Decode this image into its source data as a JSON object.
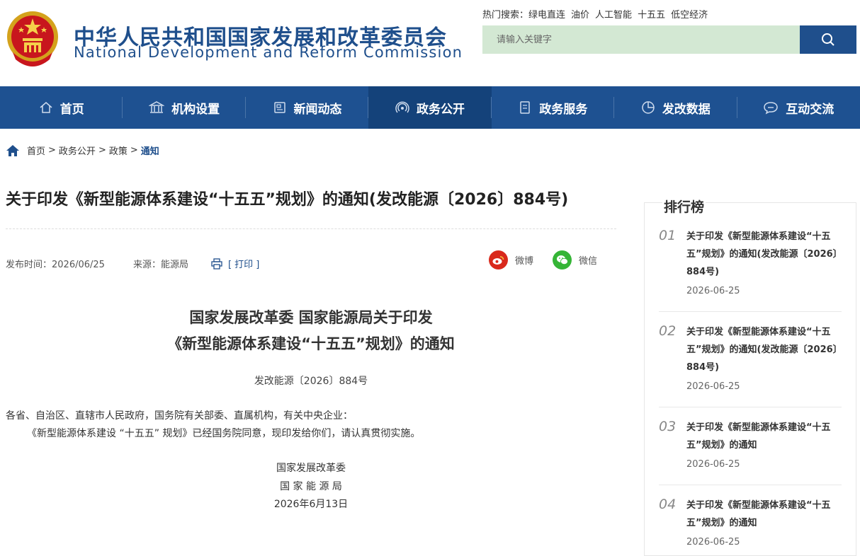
{
  "header": {
    "title": "中华人民共和国国家发展和改革委员会",
    "subtitle": "National Development and Reform Commission",
    "hot_label": "热门搜索：",
    "hot_terms": [
      "绿电直连",
      "油价",
      "人工智能",
      "十五五",
      "低空经济"
    ],
    "search_placeholder": "请输入关键字"
  },
  "nav": [
    {
      "label": "首页",
      "icon": "home-icon"
    },
    {
      "label": "机构设置",
      "icon": "building-icon"
    },
    {
      "label": "新闻动态",
      "icon": "news-icon"
    },
    {
      "label": "政务公开",
      "icon": "signal-icon"
    },
    {
      "label": "政务服务",
      "icon": "document-icon"
    },
    {
      "label": "发改数据",
      "icon": "pie-chart-icon"
    },
    {
      "label": "互动交流",
      "icon": "chat-icon"
    }
  ],
  "breadcrumb": [
    "首页",
    "政务公开",
    "政策",
    "通知"
  ],
  "article": {
    "title": "关于印发《新型能源体系建设“十五五”规划》的通知(发改能源〔2026〕884号)",
    "publish_label": "发布时间：2026/06/25",
    "source_label": "来源：能源局",
    "print_label": "[ 打印 ]",
    "share_weibo": "微博",
    "share_wechat": "微信",
    "doc_title_line1": "国家发展改革委 国家能源局关于印发",
    "doc_title_line2": "《新型能源体系建设“十五五”规划》的通知",
    "doc_number": "发改能源〔2026〕884号",
    "para1": "各省、自治区、直辖市人民政府，国务院有关部委、直属机构，有关中央企业：",
    "para2": "《新型能源体系建设 “十五五” 规划》已经国务院同意，现印发给你们，请认真贯彻实施。",
    "sign1": "国家发展改革委",
    "sign2": "国 家 能 源 局",
    "sign_date": "2026年6月13日"
  },
  "sidebar": {
    "heading": "排行榜",
    "items": [
      {
        "num": "01",
        "title": "关于印发《新型能源体系建设“十五五”规划》的通知(发改能源〔2026〕884号)",
        "date": "2026-06-25"
      },
      {
        "num": "02",
        "title": "关于印发《新型能源体系建设“十五五”规划》的通知(发改能源〔2026〕884号)",
        "date": "2026-06-25"
      },
      {
        "num": "03",
        "title": "关于印发《新型能源体系建设“十五五”规划》的通知",
        "date": "2026-06-25"
      },
      {
        "num": "04",
        "title": "关于印发《新型能源体系建设“十五五”规划》的通知",
        "date": "2026-06-25"
      }
    ]
  },
  "colors": {
    "brand": "#1f4f8c",
    "nav": "#1e5191",
    "search_bg": "#d3e8d3"
  }
}
